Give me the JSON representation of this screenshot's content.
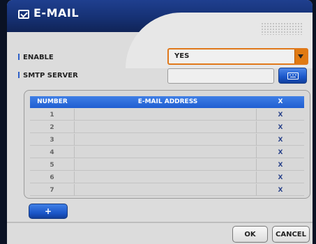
{
  "window": {
    "title": "E-MAIL",
    "icon": "email-icon"
  },
  "settings": {
    "enable_label": "ENABLE",
    "enable_value": "YES",
    "smtp_label": "SMTP SERVER",
    "smtp_value": "",
    "keyboard_icon": "keyboard-icon"
  },
  "table": {
    "headers": {
      "number": "NUMBER",
      "address": "E-MAIL ADDRESS",
      "remove": "X"
    },
    "rows": [
      {
        "number": "1",
        "address": "",
        "remove": "X"
      },
      {
        "number": "2",
        "address": "",
        "remove": "X"
      },
      {
        "number": "3",
        "address": "",
        "remove": "X"
      },
      {
        "number": "4",
        "address": "",
        "remove": "X"
      },
      {
        "number": "5",
        "address": "",
        "remove": "X"
      },
      {
        "number": "6",
        "address": "",
        "remove": "X"
      },
      {
        "number": "7",
        "address": "",
        "remove": "X"
      }
    ]
  },
  "actions": {
    "add_label": "+",
    "ok_label": "OK",
    "cancel_label": "CANCEL"
  },
  "colors": {
    "accent_blue": "#1f5ed1",
    "select_orange": "#e07a12",
    "background": "#dcdcdc"
  }
}
